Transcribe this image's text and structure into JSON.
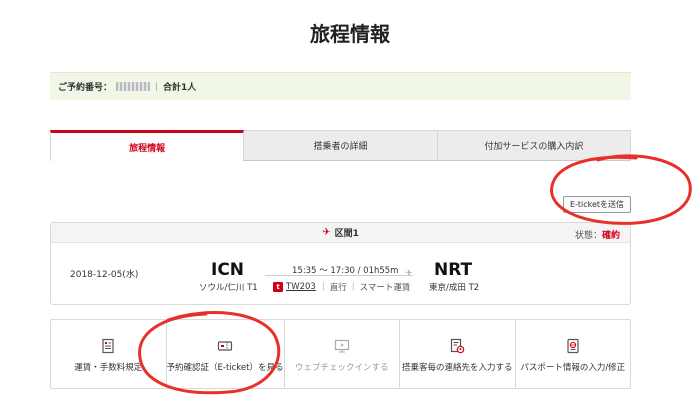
{
  "page": {
    "title": "旅程情報"
  },
  "booking": {
    "number_label": "ご予約番号：",
    "total_label": "合計1人"
  },
  "tabs": [
    {
      "label": "旅程情報",
      "active": true
    },
    {
      "label": "搭乗者の詳細",
      "active": false
    },
    {
      "label": "付加サービスの購入内訳",
      "active": false
    }
  ],
  "eticket_button": {
    "label": "E-ticketを送信"
  },
  "segment": {
    "title": "区間1",
    "status_label": "状態：",
    "status_value": "確約",
    "date": "2018-12-05(水)",
    "from_code": "ICN",
    "from_city": "ソウル/仁川 T1",
    "to_code": "NRT",
    "to_city": "東京/成田 T2",
    "time": "15:35 ～ 17:30 / 01h55m",
    "airline_logo": "t",
    "flight_no": "TW203",
    "route_type": "直行",
    "operation": "スマート運賃"
  },
  "actions": [
    {
      "label": "運賃・手数料規定",
      "icon": "document-list-icon",
      "enabled": true
    },
    {
      "label": "予約確認証（E-ticket）を見る",
      "icon": "ticket-icon",
      "enabled": true
    },
    {
      "label": "ウェブチェックインする",
      "icon": "monitor-icon",
      "enabled": false
    },
    {
      "label": "搭乗客毎の連絡先を入力する",
      "icon": "contact-doc-icon",
      "enabled": true
    },
    {
      "label": "パスポート情報の入力/修正",
      "icon": "passport-icon",
      "enabled": true
    }
  ],
  "colors": {
    "accent": "#d0021b",
    "annotation": "#e8302a",
    "booking_bar_bg": "#f1f7e6"
  }
}
